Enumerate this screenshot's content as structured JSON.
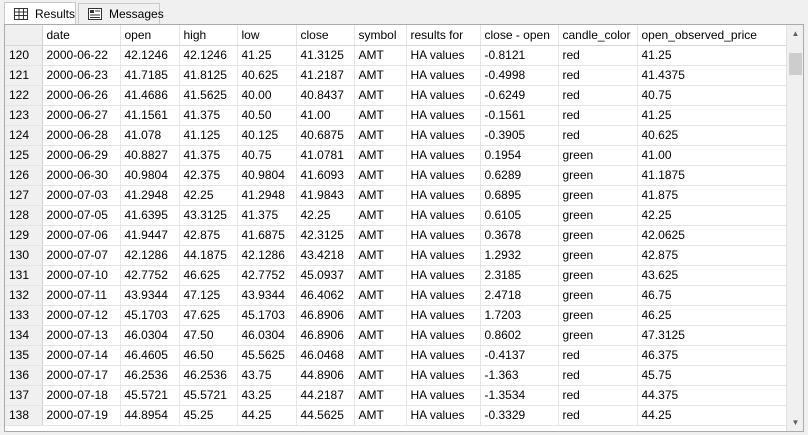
{
  "tabs": [
    {
      "label": "Results",
      "icon": "grid-icon",
      "active": true
    },
    {
      "label": "Messages",
      "icon": "messages-icon",
      "active": false
    }
  ],
  "columns": [
    "",
    "date",
    "open",
    "high",
    "low",
    "close",
    "symbol",
    "results for",
    "close - open",
    "candle_color",
    "open_observed_price"
  ],
  "rows": [
    [
      "120",
      "2000-06-22",
      "42.1246",
      "42.1246",
      "41.25",
      "41.3125",
      "AMT",
      "HA values",
      "-0.8121",
      "red",
      "41.25"
    ],
    [
      "121",
      "2000-06-23",
      "41.7185",
      "41.8125",
      "40.625",
      "41.2187",
      "AMT",
      "HA values",
      "-0.4998",
      "red",
      "41.4375"
    ],
    [
      "122",
      "2000-06-26",
      "41.4686",
      "41.5625",
      "40.00",
      "40.8437",
      "AMT",
      "HA values",
      "-0.6249",
      "red",
      "40.75"
    ],
    [
      "123",
      "2000-06-27",
      "41.1561",
      "41.375",
      "40.50",
      "41.00",
      "AMT",
      "HA values",
      "-0.1561",
      "red",
      "41.25"
    ],
    [
      "124",
      "2000-06-28",
      "41.078",
      "41.125",
      "40.125",
      "40.6875",
      "AMT",
      "HA values",
      "-0.3905",
      "red",
      "40.625"
    ],
    [
      "125",
      "2000-06-29",
      "40.8827",
      "41.375",
      "40.75",
      "41.0781",
      "AMT",
      "HA values",
      "0.1954",
      "green",
      "41.00"
    ],
    [
      "126",
      "2000-06-30",
      "40.9804",
      "42.375",
      "40.9804",
      "41.6093",
      "AMT",
      "HA values",
      "0.6289",
      "green",
      "41.1875"
    ],
    [
      "127",
      "2000-07-03",
      "41.2948",
      "42.25",
      "41.2948",
      "41.9843",
      "AMT",
      "HA values",
      "0.6895",
      "green",
      "41.875"
    ],
    [
      "128",
      "2000-07-05",
      "41.6395",
      "43.3125",
      "41.375",
      "42.25",
      "AMT",
      "HA values",
      "0.6105",
      "green",
      "42.25"
    ],
    [
      "129",
      "2000-07-06",
      "41.9447",
      "42.875",
      "41.6875",
      "42.3125",
      "AMT",
      "HA values",
      "0.3678",
      "green",
      "42.0625"
    ],
    [
      "130",
      "2000-07-07",
      "42.1286",
      "44.1875",
      "42.1286",
      "43.4218",
      "AMT",
      "HA values",
      "1.2932",
      "green",
      "42.875"
    ],
    [
      "131",
      "2000-07-10",
      "42.7752",
      "46.625",
      "42.7752",
      "45.0937",
      "AMT",
      "HA values",
      "2.3185",
      "green",
      "43.625"
    ],
    [
      "132",
      "2000-07-11",
      "43.9344",
      "47.125",
      "43.9344",
      "46.4062",
      "AMT",
      "HA values",
      "2.4718",
      "green",
      "46.75"
    ],
    [
      "133",
      "2000-07-12",
      "45.1703",
      "47.625",
      "45.1703",
      "46.8906",
      "AMT",
      "HA values",
      "1.7203",
      "green",
      "46.25"
    ],
    [
      "134",
      "2000-07-13",
      "46.0304",
      "47.50",
      "46.0304",
      "46.8906",
      "AMT",
      "HA values",
      "0.8602",
      "green",
      "47.3125"
    ],
    [
      "135",
      "2000-07-14",
      "46.4605",
      "46.50",
      "45.5625",
      "46.0468",
      "AMT",
      "HA values",
      "-0.4137",
      "red",
      "46.375"
    ],
    [
      "136",
      "2000-07-17",
      "46.2536",
      "46.2536",
      "43.75",
      "44.8906",
      "AMT",
      "HA values",
      "-1.363",
      "red",
      "45.75"
    ],
    [
      "137",
      "2000-07-18",
      "45.5721",
      "45.5721",
      "43.25",
      "44.2187",
      "AMT",
      "HA values",
      "-1.3534",
      "red",
      "44.375"
    ],
    [
      "138",
      "2000-07-19",
      "44.8954",
      "45.25",
      "44.25",
      "44.5625",
      "AMT",
      "HA values",
      "-0.3329",
      "red",
      "44.25"
    ]
  ],
  "scrollbar": {
    "up_glyph": "▲",
    "down_glyph": "▼"
  }
}
